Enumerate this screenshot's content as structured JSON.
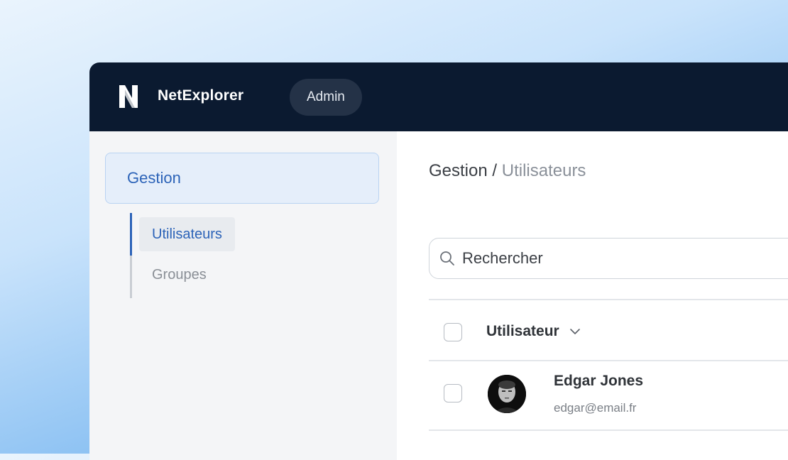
{
  "header": {
    "brand": "NetExplorer",
    "role_badge": "Admin"
  },
  "sidebar": {
    "section": "Gestion",
    "items": [
      {
        "label": "Utilisateurs",
        "active": true
      },
      {
        "label": "Groupes",
        "active": false
      }
    ]
  },
  "main": {
    "breadcrumb": {
      "section": "Gestion",
      "separator": "/",
      "page": "Utilisateurs"
    },
    "search": {
      "placeholder": "Rechercher"
    },
    "table": {
      "column_header": "Utilisateur",
      "rows": [
        {
          "name": "Edgar Jones",
          "email": "edgar@email.fr"
        }
      ]
    }
  },
  "colors": {
    "topbar": "#0b1a30",
    "accent": "#2c63b8",
    "sidebar_bg": "#f4f5f7"
  }
}
